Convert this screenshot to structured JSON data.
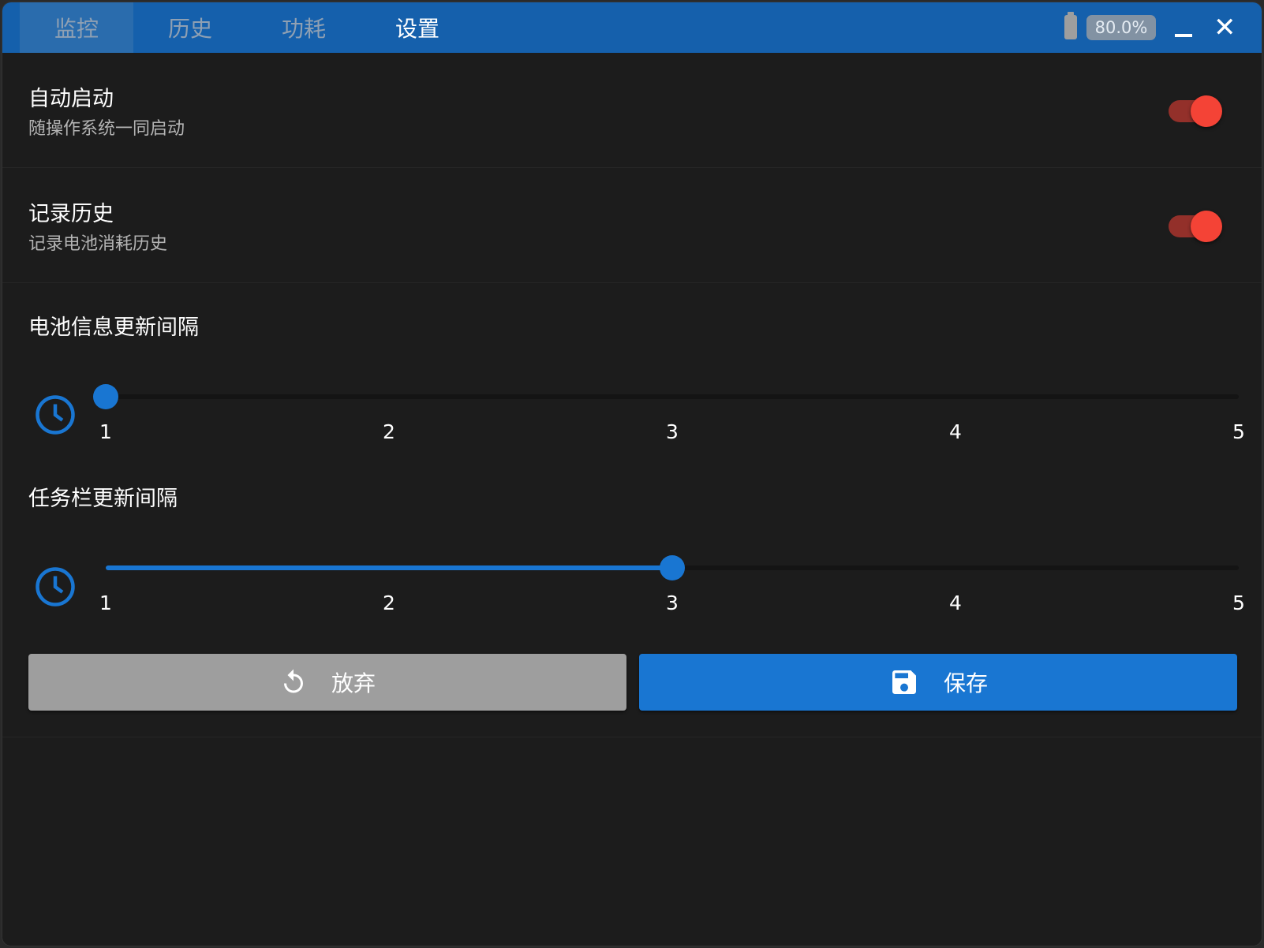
{
  "tabs": [
    {
      "label": "监控"
    },
    {
      "label": "历史"
    },
    {
      "label": "功耗"
    },
    {
      "label": "设置"
    }
  ],
  "active_tab": "设置",
  "battery": {
    "percent_label": "80.0%",
    "icon": "battery-icon"
  },
  "window": {
    "minimize": "_",
    "close": "✕"
  },
  "settings": [
    {
      "title": "自动启动",
      "subtitle": "随操作系统一同启动",
      "enabled": true
    },
    {
      "title": "记录历史",
      "subtitle": "记录电池消耗历史",
      "enabled": true
    }
  ],
  "sliders": [
    {
      "title": "电池信息更新间隔",
      "value": 1,
      "min": 1,
      "max": 5,
      "ticks": [
        "1",
        "2",
        "3",
        "4",
        "5"
      ]
    },
    {
      "title": "任务栏更新间隔",
      "value": 3,
      "min": 1,
      "max": 5,
      "ticks": [
        "1",
        "2",
        "3",
        "4",
        "5"
      ]
    }
  ],
  "buttons": {
    "discard": "放弃",
    "save": "保存"
  },
  "colors": {
    "accent": "#1976d2",
    "titlebar": "#1560ac",
    "toggle": "#f44336",
    "bg": "#1c1c1c"
  }
}
